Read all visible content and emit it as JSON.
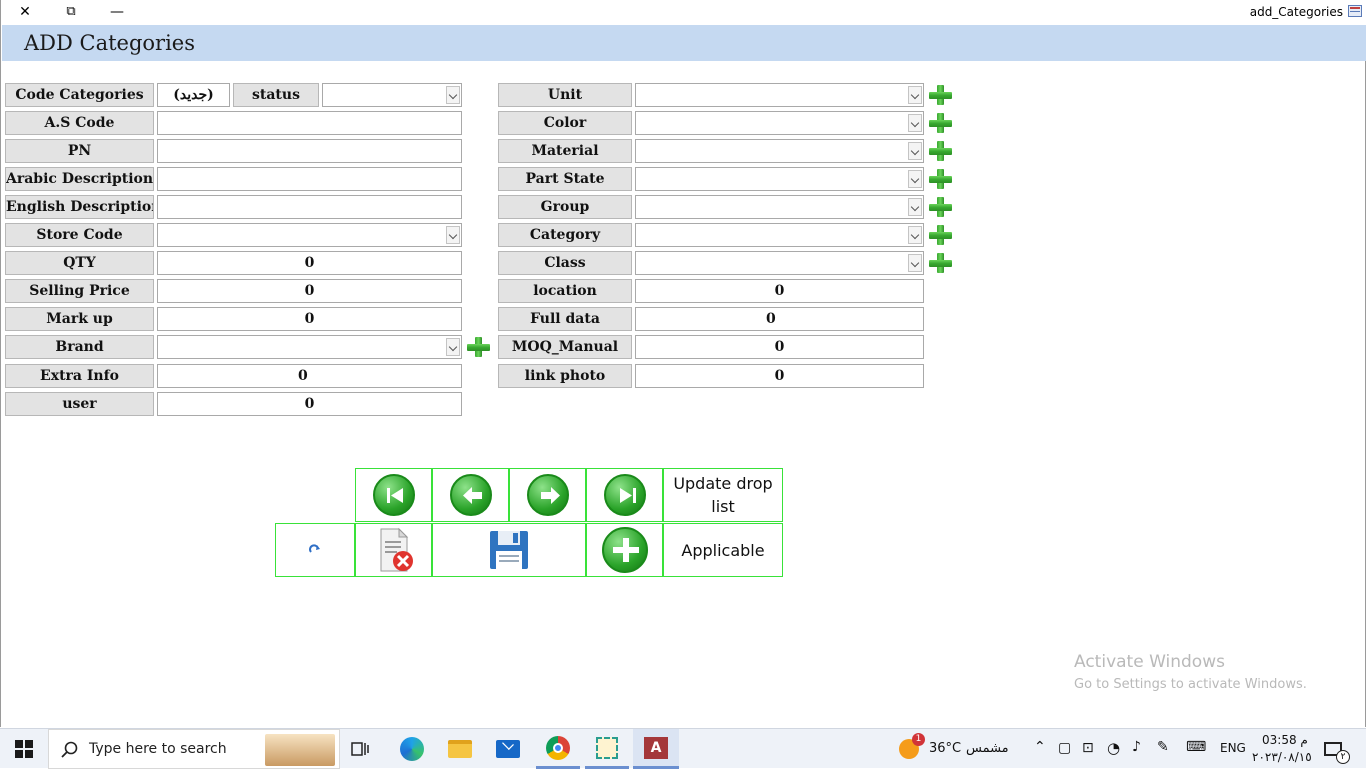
{
  "window": {
    "title": "add_Categories",
    "close": "✕",
    "restore": "⧉",
    "minimize": "—"
  },
  "header": {
    "title": "ADD Categories"
  },
  "left": {
    "code_categories_label": "Code Categories",
    "code_categories_value": "(جديد)",
    "status_label": "status",
    "status_value": "",
    "as_code_label": "A.S Code",
    "as_code_value": "",
    "pn_label": "PN",
    "pn_value": "",
    "arabic_desc_label": "Arabic Description",
    "arabic_desc_value": "",
    "english_desc_label": "English Description",
    "english_desc_value": "",
    "store_code_label": "Store Code",
    "qty_label": "QTY",
    "qty_value": "0",
    "selling_price_label": "Selling Price",
    "selling_price_value": "0",
    "markup_label": "Mark up",
    "markup_value": "0",
    "brand_label": "Brand",
    "extra_info_label": "Extra Info",
    "extra_info_value": "0",
    "user_label": "user",
    "user_value": "0"
  },
  "right": {
    "unit_label": "Unit",
    "color_label": "Color",
    "material_label": "Material",
    "part_state_label": "Part State",
    "group_label": "Group",
    "category_label": "Category",
    "class_label": "Class",
    "location_label": "location",
    "location_value": "0",
    "full_data_label": "Full data",
    "full_data_value": "0",
    "moq_label": "MOQ_Manual",
    "moq_value": "0",
    "link_photo_label": "link photo",
    "link_photo_value": "0"
  },
  "buttons": {
    "update_drop_list": "Update drop list",
    "applicable": "Applicable"
  },
  "watermark": {
    "line1": "Activate Windows",
    "line2": "Go to Settings to activate Windows."
  },
  "taskbar": {
    "search_placeholder": "Type here to search",
    "weather_temp": "36°C",
    "weather_text": "مشمس",
    "weather_badge": "1",
    "lang": "ENG",
    "time": "03:58 م",
    "date": "٢٠٢٣/٠٨/١٥",
    "notif_count": "٢"
  },
  "colors": {
    "header_bg": "#c5d9f1",
    "button_border": "#39e239",
    "plus_green": "#38a830"
  }
}
